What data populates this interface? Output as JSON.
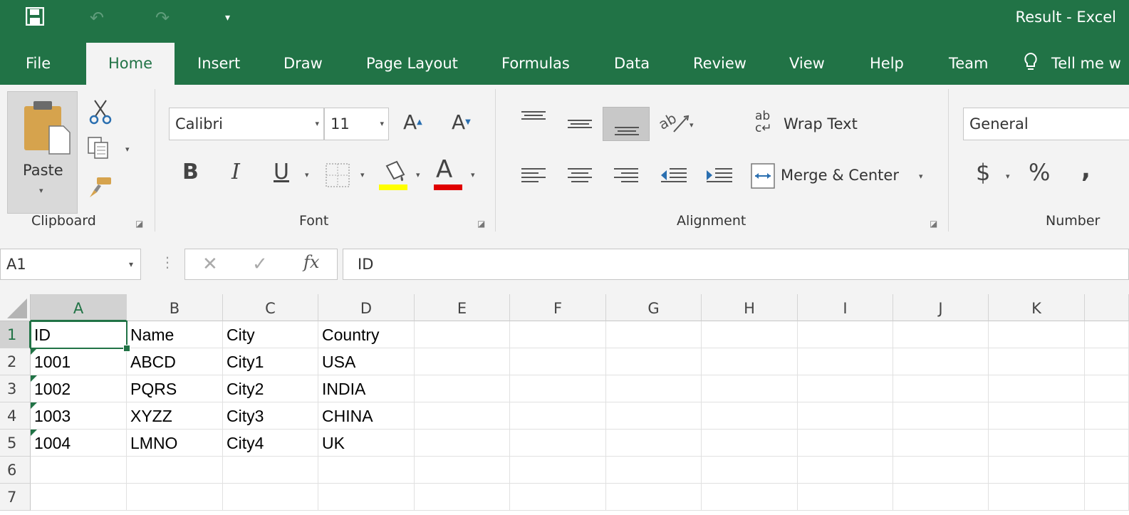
{
  "window": {
    "title": "Result  -  Excel"
  },
  "quick_access": {
    "save_icon": "save-icon",
    "undo_icon": "undo-icon",
    "redo_icon": "redo-icon",
    "customize_icon": "customize-icon"
  },
  "tabs": [
    {
      "label": "File"
    },
    {
      "label": "Home"
    },
    {
      "label": "Insert"
    },
    {
      "label": "Draw"
    },
    {
      "label": "Page Layout"
    },
    {
      "label": "Formulas"
    },
    {
      "label": "Data"
    },
    {
      "label": "Review"
    },
    {
      "label": "View"
    },
    {
      "label": "Help"
    },
    {
      "label": "Team"
    },
    {
      "label": "Tell me w"
    }
  ],
  "ribbon": {
    "clipboard": {
      "label": "Clipboard",
      "paste_label": "Paste"
    },
    "font": {
      "label": "Font",
      "font_name": "Calibri",
      "font_size": "11",
      "bold": "B",
      "italic": "I",
      "underline": "U",
      "font_color_glyph": "A",
      "grow_glyph": "A",
      "shrink_glyph": "A",
      "highlight_color": "#ffff00",
      "font_color": "#e00000"
    },
    "alignment": {
      "label": "Alignment",
      "wrap_text": "Wrap Text",
      "merge_center": "Merge & Center"
    },
    "number": {
      "label": "Number",
      "format": "General",
      "currency": "$",
      "percent": "%",
      "comma": ","
    }
  },
  "formula_bar": {
    "name_box": "A1",
    "fx": "fx",
    "value": "ID"
  },
  "sheet": {
    "columns": [
      "A",
      "B",
      "C",
      "D",
      "E",
      "F",
      "G",
      "H",
      "I",
      "J",
      "K"
    ],
    "rows": [
      "1",
      "2",
      "3",
      "4",
      "5",
      "6",
      "7"
    ],
    "cells": [
      [
        "ID",
        "Name",
        "City",
        "Country"
      ],
      [
        "1001",
        "ABCD",
        "City1",
        "USA"
      ],
      [
        "1002",
        "PQRS",
        "City2",
        "INDIA"
      ],
      [
        "1003",
        "XYZZ",
        "City3",
        "CHINA"
      ],
      [
        "1004",
        "LMNO",
        "City4",
        "UK"
      ],
      [
        "",
        "",
        "",
        ""
      ],
      [
        "",
        "",
        "",
        ""
      ]
    ],
    "active_cell": "A1"
  },
  "colors": {
    "accent": "#217346"
  }
}
